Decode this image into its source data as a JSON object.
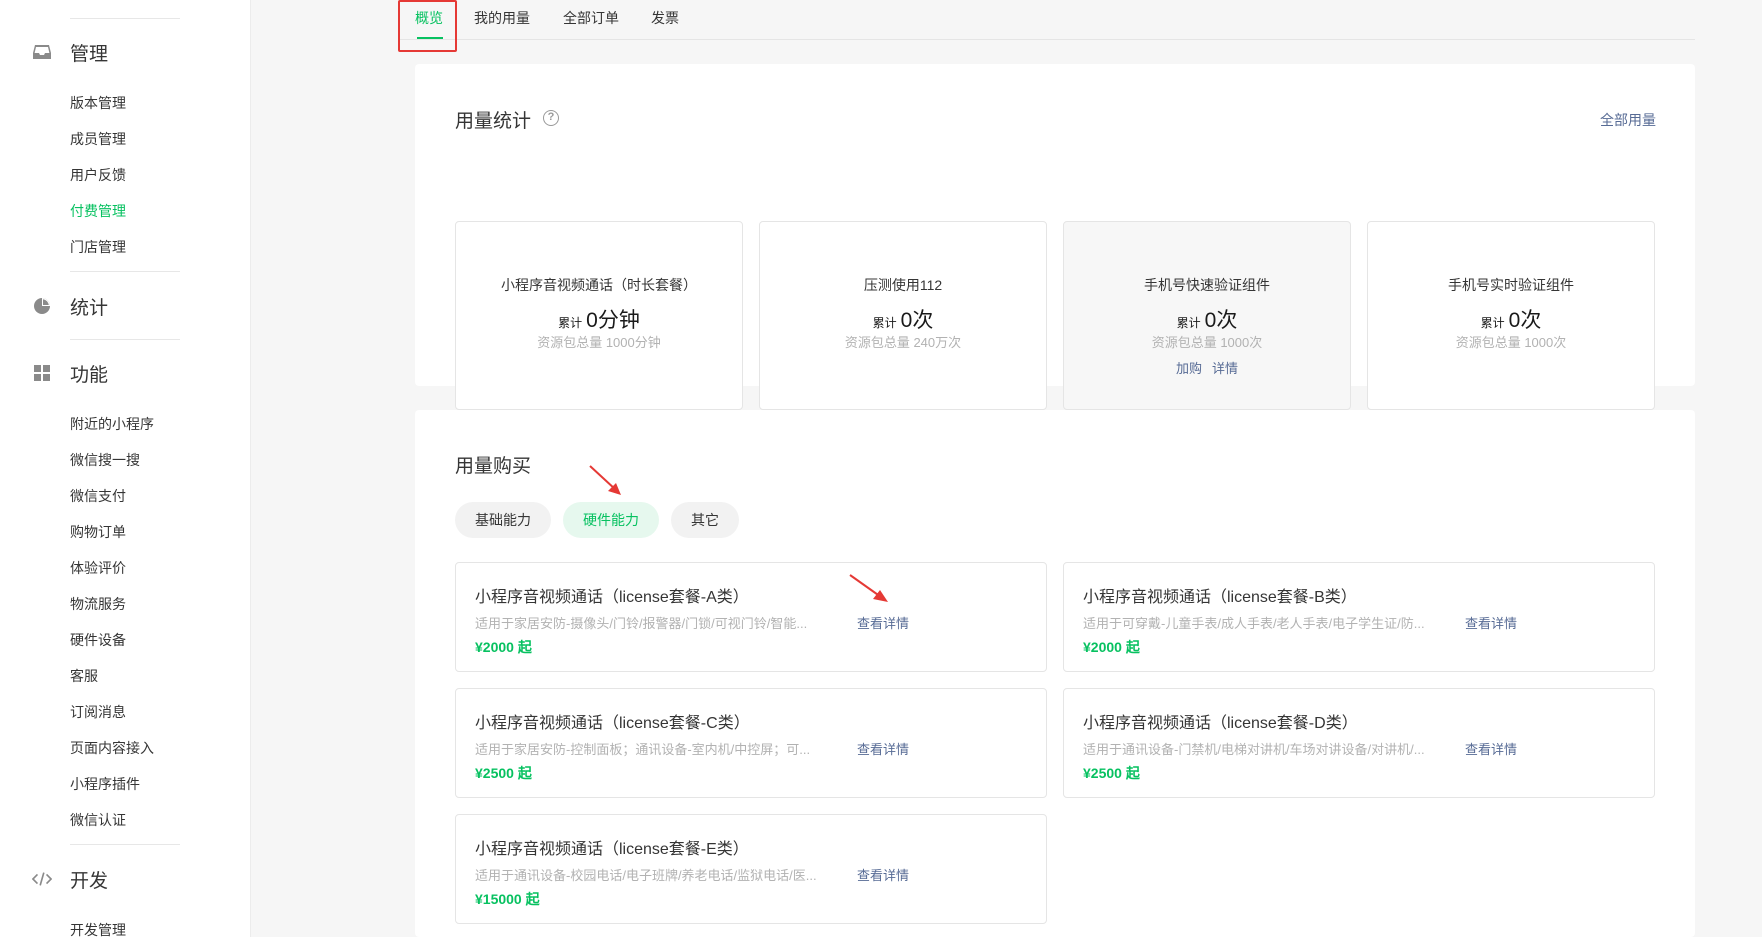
{
  "sidebar": {
    "sections": [
      {
        "icon": "inbox-icon",
        "label": "管理"
      },
      {
        "icon": "pie-chart-icon",
        "label": "统计"
      },
      {
        "icon": "grid-icon",
        "label": "功能"
      },
      {
        "icon": "code-icon",
        "label": "开发"
      }
    ],
    "manage_items": [
      "版本管理",
      "成员管理",
      "用户反馈",
      "付费管理",
      "门店管理"
    ],
    "feature_items": [
      "附近的小程序",
      "微信搜一搜",
      "微信支付",
      "购物订单",
      "体验评价",
      "物流服务",
      "硬件设备",
      "客服",
      "订阅消息",
      "页面内容接入",
      "小程序插件",
      "微信认证"
    ],
    "dev_items": [
      "开发管理"
    ],
    "active_item": "付费管理"
  },
  "tabs": [
    "概览",
    "我的用量",
    "全部订单",
    "发票"
  ],
  "active_tab": "概览",
  "usage_stats": {
    "title": "用量统计",
    "all_usage_link": "全部用量",
    "cards": [
      {
        "name": "小程序音视频通话（时长套餐）",
        "total_prefix": "累计",
        "total": "0分钟",
        "quota": "资源包总量 1000分钟"
      },
      {
        "name": "压测使用112",
        "total_prefix": "累计",
        "total": "0次",
        "quota": "资源包总量 240万次"
      },
      {
        "name": "手机号快速验证组件",
        "total_prefix": "累计",
        "total": "0次",
        "quota": "资源包总量 1000次",
        "links": [
          "加购",
          "详情"
        ]
      },
      {
        "name": "手机号实时验证组件",
        "total_prefix": "累计",
        "total": "0次",
        "quota": "资源包总量 1000次"
      }
    ]
  },
  "purchase": {
    "title": "用量购买",
    "chips": [
      "基础能力",
      "硬件能力",
      "其它"
    ],
    "active_chip": "硬件能力",
    "detail_label": "查看详情",
    "packages": [
      {
        "title": "小程序音视频通话（license套餐-A类）",
        "desc": "适用于家居安防-摄像头/门铃/报警器/门锁/可视门铃/智能...",
        "price": "¥2000 起"
      },
      {
        "title": "小程序音视频通话（license套餐-B类）",
        "desc": "适用于可穿戴-儿童手表/成人手表/老人手表/电子学生证/防...",
        "price": "¥2000 起"
      },
      {
        "title": "小程序音视频通话（license套餐-C类）",
        "desc": "适用于家居安防-控制面板；通讯设备-室内机/中控屏；可...",
        "price": "¥2500 起"
      },
      {
        "title": "小程序音视频通话（license套餐-D类）",
        "desc": "适用于通讯设备-门禁机/电梯对讲机/车场对讲设备/对讲机/...",
        "price": "¥2500 起"
      },
      {
        "title": "小程序音视频通话（license套餐-E类）",
        "desc": "适用于通讯设备-校园电话/电子班牌/养老电话/监狱电话/医...",
        "price": "¥15000 起"
      }
    ]
  },
  "colors": {
    "accent": "#07c160",
    "link": "#576b95",
    "annotation": "#e53935"
  }
}
